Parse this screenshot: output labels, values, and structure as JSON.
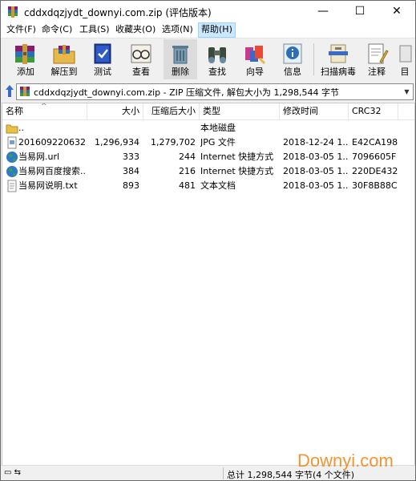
{
  "window": {
    "title": "cddxdqzjydt_downyi.com.zip (评估版本)",
    "minimize": "—",
    "maximize": "☐",
    "close": "✕"
  },
  "menu": [
    {
      "label": "文件(F)"
    },
    {
      "label": "命令(C)"
    },
    {
      "label": "工具(S)"
    },
    {
      "label": "收藏夹(O)"
    },
    {
      "label": "选项(N)"
    },
    {
      "label": "帮助(H)"
    }
  ],
  "toolbar": [
    {
      "label": "添加",
      "icon": "add-books-icon"
    },
    {
      "label": "解压到",
      "icon": "extract-folder-icon"
    },
    {
      "label": "测试",
      "icon": "test-book-icon"
    },
    {
      "label": "查看",
      "icon": "view-glasses-icon"
    },
    {
      "label": "删除",
      "icon": "delete-trash-icon"
    },
    {
      "label": "查找",
      "icon": "find-binoculars-icon"
    },
    {
      "label": "向导",
      "icon": "wizard-icon"
    },
    {
      "label": "信息",
      "icon": "info-icon"
    },
    {
      "label": "扫描病毒",
      "icon": "scan-virus-icon"
    },
    {
      "label": "注释",
      "icon": "comment-icon"
    },
    {
      "label": "目",
      "icon": "more-icon"
    }
  ],
  "address": {
    "text": "cddxdqzjydt_downyi.com.zip - ZIP 压缩文件, 解包大小为 1,298,544 字节"
  },
  "columns": {
    "name": "名称",
    "size": "大小",
    "packed": "压缩后大小",
    "type": "类型",
    "modified": "修改时间",
    "crc": "CRC32"
  },
  "files": [
    {
      "name": "..",
      "size": "",
      "packed": "",
      "type": "本地磁盘",
      "modified": "",
      "crc": "",
      "icon": "folder-icon"
    },
    {
      "name": "201609220632...",
      "size": "1,296,934",
      "packed": "1,279,702",
      "type": "JPG 文件",
      "modified": "2018-12-24 1...",
      "crc": "E42CA198",
      "icon": "image-file-icon"
    },
    {
      "name": "当易网.url",
      "size": "333",
      "packed": "244",
      "type": "Internet 快捷方式",
      "modified": "2018-03-05 1...",
      "crc": "7096605F",
      "icon": "internet-globe-icon"
    },
    {
      "name": "当易网百度搜索...",
      "size": "384",
      "packed": "216",
      "type": "Internet 快捷方式",
      "modified": "2018-03-05 1...",
      "crc": "220DE432",
      "icon": "internet-globe-icon"
    },
    {
      "name": "当易网说明.txt",
      "size": "893",
      "packed": "481",
      "type": "文本文档",
      "modified": "2018-03-05 1...",
      "crc": "30F8B88C",
      "icon": "text-file-icon"
    }
  ],
  "status": {
    "summary": "总计 1,298,544 字节(4 个文件)"
  },
  "watermark": "Downyi.com"
}
